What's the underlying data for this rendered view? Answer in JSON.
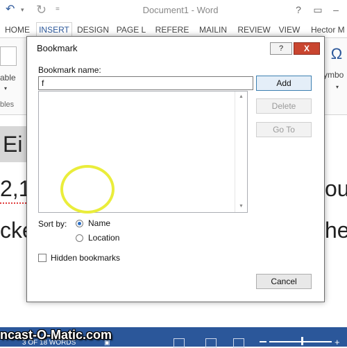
{
  "window": {
    "title": "Document1 - Word",
    "minimize_glyph": "?",
    "restore_glyph": "–"
  },
  "quick_access": {
    "undo_glyph": "↶",
    "dropdown_glyph": "▾",
    "redo_glyph": "↻",
    "customize_glyph": "="
  },
  "ribbon": {
    "tabs": [
      "HOME",
      "INSERT",
      "DESIGN",
      "PAGE L",
      "REFERE",
      "MAILIN",
      "REVIEW",
      "VIEW"
    ],
    "active_tab": "INSERT",
    "user": "Hector M",
    "left_group": {
      "label": "able",
      "caret": "▾",
      "group_name": "bles"
    },
    "symbol": {
      "glyph": "Ω",
      "label": "ymbo",
      "caret": "▾"
    }
  },
  "document": {
    "heading_fragment": "Ei",
    "line1_left": "2,1",
    "line1_right": "oul",
    "line2_left": "cke",
    "line2_right": "he"
  },
  "dialog": {
    "title": "Bookmark",
    "help_glyph": "?",
    "close_glyph": "X",
    "bookmark_name_label": "Bookmark name:",
    "bookmark_name_value": "f",
    "bookmark_list": [],
    "scroll_up_glyph": "▲",
    "scroll_down_glyph": "▼",
    "buttons": {
      "add": "Add",
      "delete": "Delete",
      "goto": "Go To",
      "cancel": "Cancel"
    },
    "sort_by_label": "Sort by:",
    "sort_options": [
      "Name",
      "Location"
    ],
    "sort_selected": "Name",
    "hidden_bookmarks_label": "Hidden bookmarks",
    "hidden_bookmarks_checked": false
  },
  "status_bar": {
    "page_words": "3 OF 18 WORDS",
    "proofing_icon": "proofing-icon",
    "zoom_plus": "+"
  },
  "watermark": "ncast-O-Matic.com",
  "colors": {
    "accent": "#2b579a",
    "close_button": "#c9452f",
    "cursor_highlight": "#eaed3b"
  }
}
